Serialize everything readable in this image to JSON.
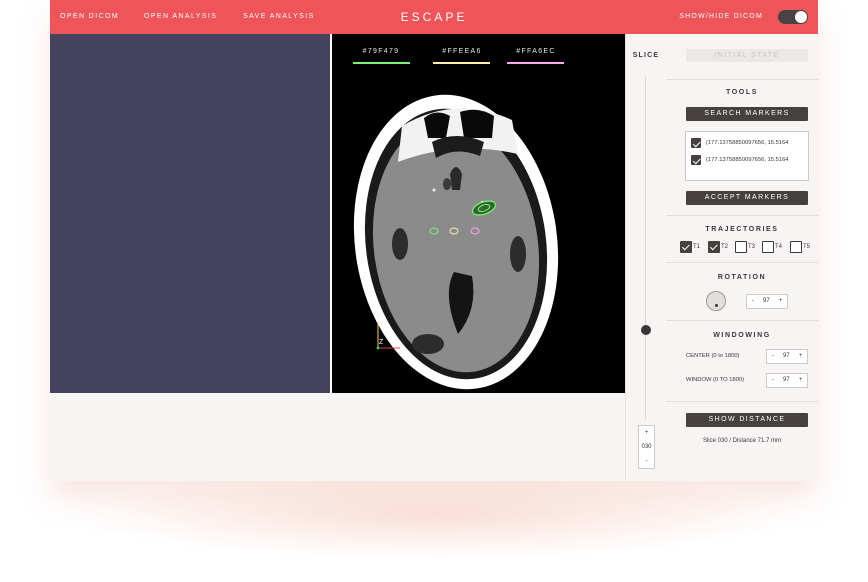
{
  "topbar": {
    "menu": [
      "OPEN DICOM",
      "OPEN ANALYSIS",
      "SAVE ANALYSIS"
    ],
    "title": "ESCAPE",
    "toggle_label": "SHOW/HIDE DICOM",
    "toggle_on": true
  },
  "colors": {
    "accent": "#ef5458",
    "dark_button": "#46403f",
    "left_viewport": "#46435e"
  },
  "viewer": {
    "trajectory_colors": [
      {
        "label": "#79F479",
        "color": "#79F479"
      },
      {
        "label": "#FFEEA6",
        "color": "#FFEEA6"
      },
      {
        "label": "#FFA6EC",
        "color": "#FFA6EC"
      }
    ],
    "axis_label": "Z"
  },
  "slice": {
    "label": "SLICE",
    "plus": "+",
    "value": "030",
    "minus": "-"
  },
  "panel": {
    "initial_state_label": "INITIAL STATE",
    "tools_title": "TOOLS",
    "search_markers_label": "SEARCH MARKERS",
    "markers": [
      {
        "text": "(177.13758850097656, 15.5164",
        "checked": true
      },
      {
        "text": "(177.13758850097656, 15.5164",
        "checked": true
      }
    ],
    "accept_markers_label": "ACCEPT MARKERS",
    "trajectories_title": "TRAJECTORIES",
    "trajectories": [
      {
        "label": "T1",
        "checked": true
      },
      {
        "label": "T2",
        "checked": true
      },
      {
        "label": "T3",
        "checked": false
      },
      {
        "label": "T4",
        "checked": false
      },
      {
        "label": "T5",
        "checked": false
      }
    ],
    "rotation_title": "ROTATION",
    "rotation": {
      "minus": "-",
      "value": "97",
      "plus": "+"
    },
    "windowing_title": "WINDOWING",
    "center_label": "CENTER (0 to 1800)",
    "center": {
      "minus": "-",
      "value": "97",
      "plus": "+"
    },
    "window_label": "WINDOW (0 TO 1800)",
    "window": {
      "minus": "-",
      "value": "97",
      "plus": "+"
    },
    "show_distance_label": "SHOW DISTANCE",
    "status": "Slice 030  /  Distance 71.7 mm"
  }
}
